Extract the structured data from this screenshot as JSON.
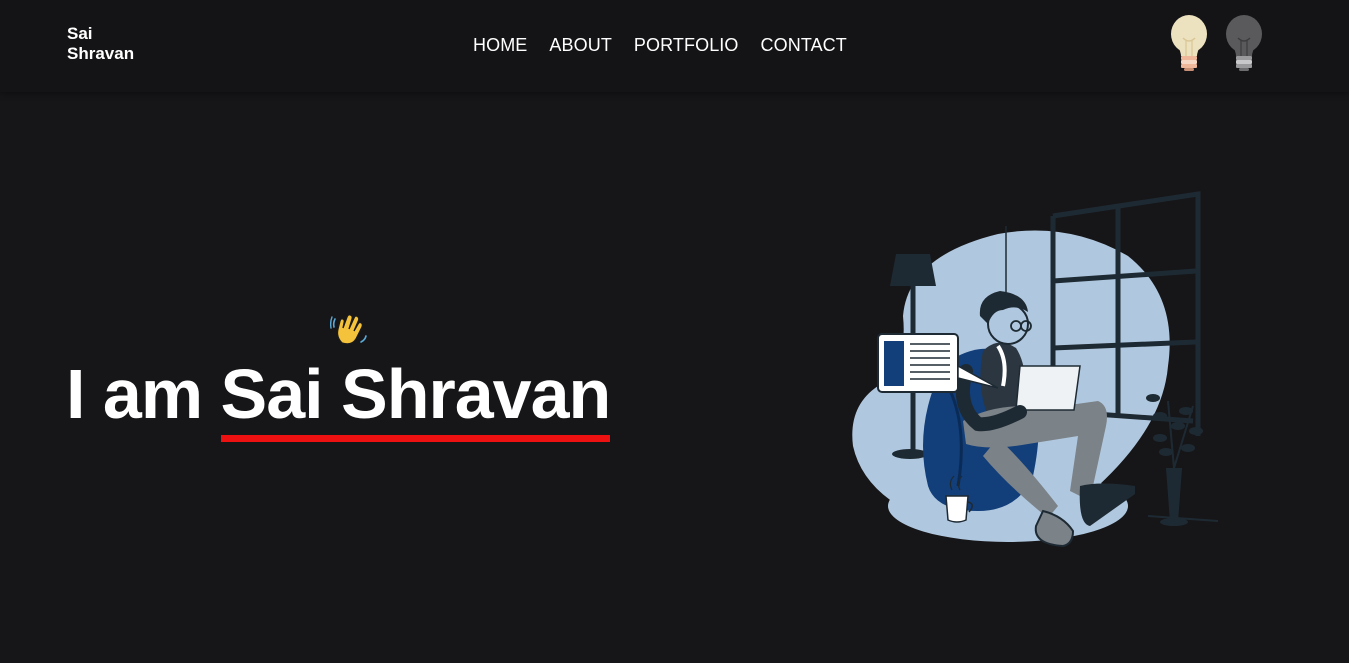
{
  "nav": {
    "brand": "Sai Shravan",
    "links": [
      "HOME",
      "ABOUT",
      "PORTFOLIO",
      "CONTACT"
    ]
  },
  "theme_toggle": {
    "light_icon": "light-bulb-on-icon",
    "dark_icon": "light-bulb-off-icon"
  },
  "hero": {
    "emoji": "👋",
    "prefix": "I am ",
    "name": "Sai Shravan",
    "underline_color": "#ee1111"
  },
  "illustration": {
    "icon": "person-on-beanbag-with-laptop-illustration"
  },
  "colors": {
    "background": "#161618",
    "navbar": "#141416",
    "text": "#ffffff",
    "accent": "#ee1111",
    "illustration_light": "#b0c8df",
    "illustration_dark": "#1e2a33",
    "illustration_blue": "#123e7a"
  }
}
